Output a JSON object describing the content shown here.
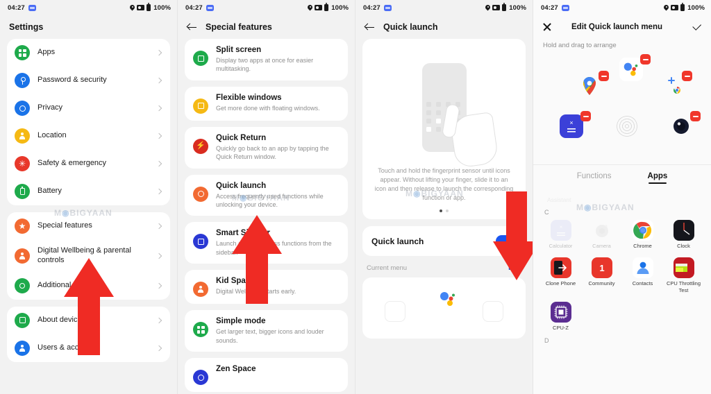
{
  "status_bar": {
    "time": "04:27",
    "battery": "100%",
    "icons": [
      "location-pin",
      "screen-record",
      "battery"
    ]
  },
  "watermark": "MOBIGYAAN",
  "panel1": {
    "title": "Settings",
    "groups": [
      {
        "items": [
          {
            "label": "Apps",
            "icon": "apps-grid-icon",
            "color": "#1eaa4b"
          },
          {
            "label": "Password & security",
            "icon": "key-icon",
            "color": "#1a73e8"
          },
          {
            "label": "Privacy",
            "icon": "privacy-icon",
            "color": "#1a73e8"
          },
          {
            "label": "Location",
            "icon": "location-icon",
            "color": "#f5b914"
          },
          {
            "label": "Safety & emergency",
            "icon": "safety-icon",
            "color": "#e8382a"
          },
          {
            "label": "Battery",
            "icon": "battery-icon",
            "color": "#1eaa4b"
          }
        ]
      },
      {
        "items": [
          {
            "label": "Special features",
            "icon": "star-icon",
            "color": "#f26a32"
          },
          {
            "label": "Digital Wellbeing & parental controls",
            "icon": "wellbeing-icon",
            "color": "#f26a32"
          },
          {
            "label": "Additional settings",
            "icon": "gear-icon",
            "color": "#1eaa4b"
          }
        ]
      },
      {
        "items": [
          {
            "label": "About device",
            "icon": "device-icon",
            "color": "#1eaa4b"
          },
          {
            "label": "Users & accounts",
            "icon": "user-icon",
            "color": "#1a73e8"
          }
        ]
      }
    ]
  },
  "panel2": {
    "title": "Special features",
    "features": [
      {
        "title": "Split screen",
        "desc": "Display two apps at once for easier multitasking.",
        "color": "#1eaa4b",
        "icon": "split-screen-icon"
      },
      {
        "title": "Flexible windows",
        "desc": "Get more done with floating windows.",
        "color": "#f5b914",
        "icon": "flexible-windows-icon"
      },
      {
        "title": "Quick Return",
        "desc": "Quickly go back to an app by tapping the Quick Return window.",
        "color": "#d92c20",
        "icon": "quick-return-icon"
      },
      {
        "title": "Quick launch",
        "desc": "Access frequently used functions while unlocking your device.",
        "color": "#f26a32",
        "icon": "quick-launch-icon"
      },
      {
        "title": "Smart Sidebar",
        "desc": "Launch apps or access functions from the sidebar.",
        "color": "#2a38d4",
        "icon": "smart-sidebar-icon"
      },
      {
        "title": "Kid Space",
        "desc": "Digital Wellbeing starts early.",
        "color": "#f26a32",
        "icon": "kid-space-icon"
      },
      {
        "title": "Simple mode",
        "desc": "Get larger text, bigger icons and louder sounds.",
        "color": "#1eaa4b",
        "icon": "simple-mode-icon"
      },
      {
        "title": "Zen Space",
        "desc": "",
        "color": "#2a38d4",
        "icon": "zen-space-icon"
      }
    ]
  },
  "panel3": {
    "title": "Quick launch",
    "illustration_caption": "Touch and hold the fingerprint sensor until icons appear. Without lifting your finger, slide it to an icon and then release to launch the corresponding function or app.",
    "page_dots": 2,
    "active_dot": 0,
    "toggle_label": "Quick launch",
    "toggle_on": true,
    "toggle_color": "#1a56f0",
    "current_menu_label": "Current menu",
    "edit_label": "Edit",
    "menu_items": [
      "empty-slot",
      "google-assistant",
      "empty-slot"
    ]
  },
  "panel4": {
    "title": "Edit Quick launch menu",
    "close_icon": "close-icon",
    "confirm_icon": "check-icon",
    "hint": "Hold and drag to arrange",
    "selected": [
      {
        "name": "Google Maps",
        "icon": "google-maps-icon",
        "removable": true
      },
      {
        "name": "Google Assistant",
        "icon": "google-assistant-icon",
        "removable": true
      },
      {
        "name": "Chrome Add",
        "icon": "chrome-add-icon",
        "removable": true
      },
      {
        "name": "Calculator",
        "icon": "calculator-icon",
        "removable": true
      },
      {
        "name": "Fingerprint sensor",
        "icon": "fingerprint-ring-icon",
        "removable": false
      },
      {
        "name": "Camera",
        "icon": "camera-lens-icon",
        "removable": true
      }
    ],
    "tabs": [
      {
        "label": "Functions",
        "active": false
      },
      {
        "label": "Apps",
        "active": true
      }
    ],
    "ghost_label": "Assistant",
    "section_letter": "C",
    "section_letter_next": "D",
    "apps": [
      {
        "name": "Calculator",
        "icon": "calculator-icon",
        "dimmed": true
      },
      {
        "name": "Camera",
        "icon": "camera-icon",
        "dimmed": true
      },
      {
        "name": "Chrome",
        "icon": "chrome-icon",
        "dimmed": false
      },
      {
        "name": "Clock",
        "icon": "clock-icon",
        "dimmed": false
      },
      {
        "name": "Clone Phone",
        "icon": "clone-phone-icon",
        "dimmed": false
      },
      {
        "name": "Community",
        "icon": "community-icon",
        "dimmed": false
      },
      {
        "name": "Contacts",
        "icon": "contacts-icon",
        "dimmed": false
      },
      {
        "name": "CPU Throttling Test",
        "icon": "cpu-throttling-icon",
        "dimmed": false
      },
      {
        "name": "CPU-Z",
        "icon": "cpu-z-icon",
        "dimmed": false
      }
    ]
  }
}
